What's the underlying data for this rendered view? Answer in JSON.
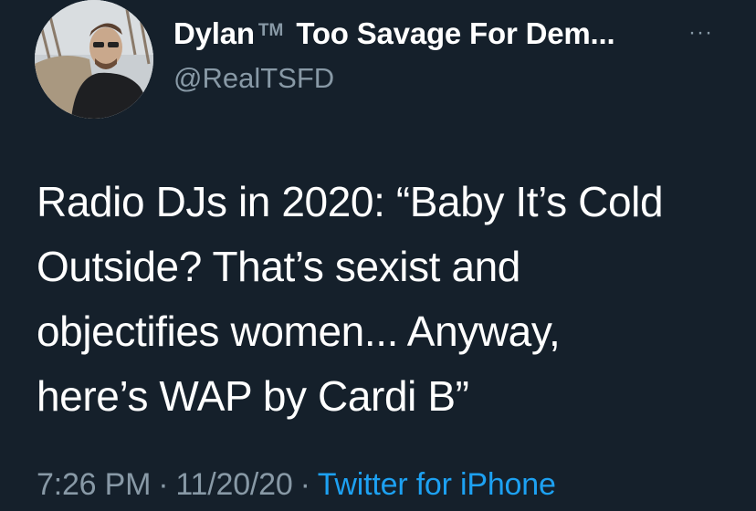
{
  "tweet": {
    "display_name": "Dylan",
    "tm_mark": "TM",
    "display_name_rest": "Too Savage For Dem...",
    "handle": "@RealTSFD",
    "more_label": "···",
    "body_lines": [
      "Radio DJs in 2020: “Baby It’s Cold",
      "Outside? That’s sexist and",
      "objectifies women... Anyway,",
      "here’s WAP by Cardi B”"
    ],
    "time": "7:26 PM",
    "date": "11/20/20",
    "separator": "·",
    "source": "Twitter for iPhone"
  },
  "colors": {
    "background": "#15202b",
    "primary_text": "#ffffff",
    "secondary_text": "#8899a6",
    "link": "#1da1f2"
  },
  "icons": {
    "more": "more-horizontal-icon",
    "avatar": "profile-photo"
  }
}
